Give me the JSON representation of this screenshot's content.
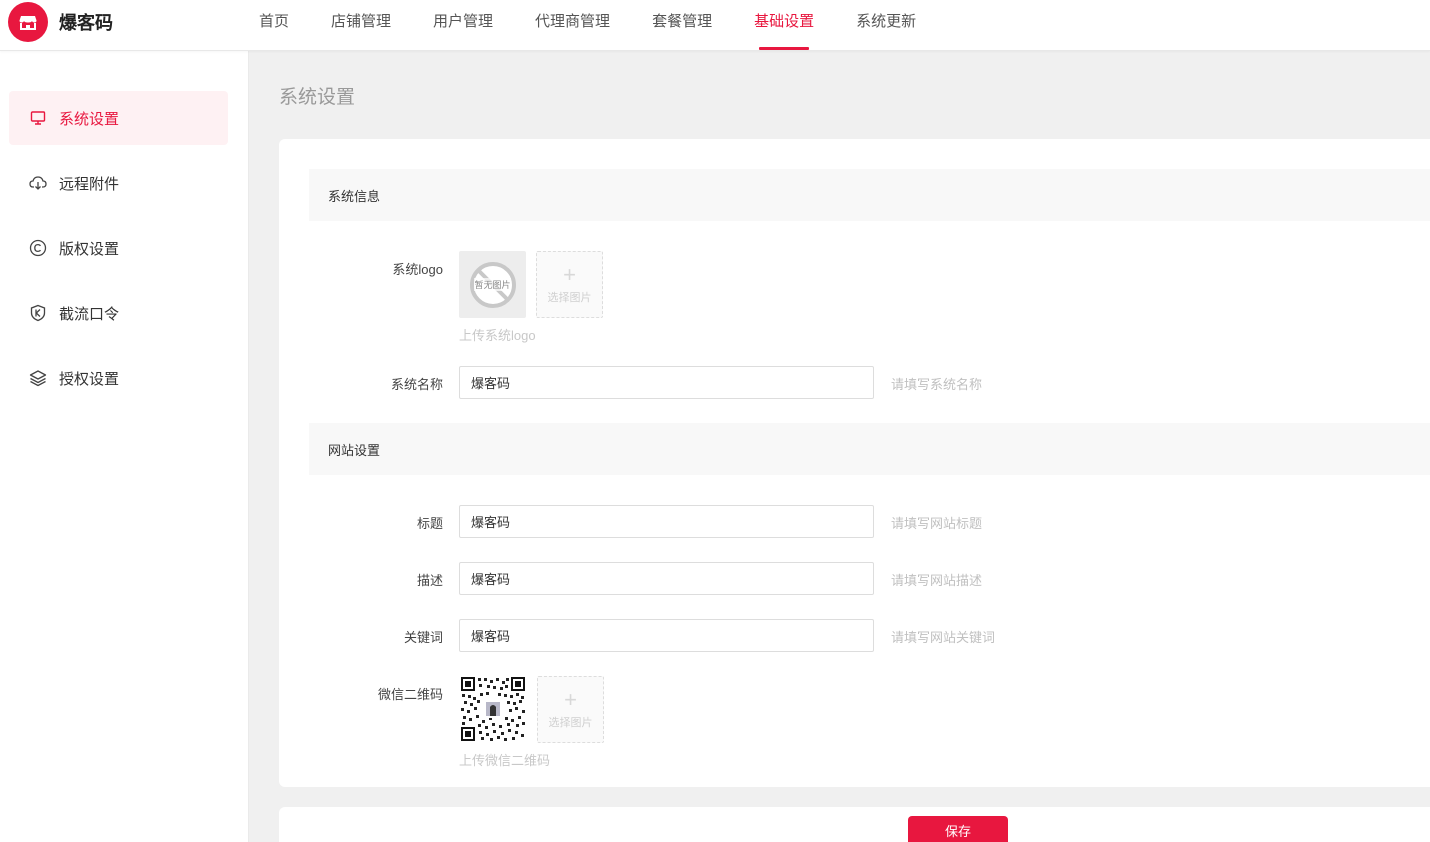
{
  "app": {
    "name": "爆客码",
    "logo_icon": "store-icon",
    "brand_color": "#e8173f"
  },
  "nav": {
    "items": [
      {
        "label": "首页"
      },
      {
        "label": "店铺管理"
      },
      {
        "label": "用户管理"
      },
      {
        "label": "代理商管理"
      },
      {
        "label": "套餐管理"
      },
      {
        "label": "基础设置",
        "active": true
      },
      {
        "label": "系统更新"
      }
    ]
  },
  "sidebar": {
    "items": [
      {
        "label": "系统设置",
        "icon": "monitor-icon",
        "active": true
      },
      {
        "label": "远程附件",
        "icon": "cloud-download-icon"
      },
      {
        "label": "版权设置",
        "icon": "copyright-icon"
      },
      {
        "label": "截流口令",
        "icon": "shield-k-icon"
      },
      {
        "label": "授权设置",
        "icon": "layers-icon"
      }
    ]
  },
  "page": {
    "title": "系统设置"
  },
  "sections": {
    "system_info": {
      "title": "系统信息",
      "logo": {
        "label": "系统logo",
        "placeholder_image_text": "暂无图片",
        "pick_label": "选择图片",
        "hint": "上传系统logo"
      },
      "name": {
        "label": "系统名称",
        "value": "爆客码",
        "hint": "请填写系统名称"
      }
    },
    "site_settings": {
      "title": "网站设置",
      "title_field": {
        "label": "标题",
        "value": "爆客码",
        "hint": "请填写网站标题"
      },
      "description": {
        "label": "描述",
        "value": "爆客码",
        "hint": "请填写网站描述"
      },
      "keywords": {
        "label": "关键词",
        "value": "爆客码",
        "hint": "请填写网站关键词"
      },
      "wechat_qr": {
        "label": "微信二维码",
        "pick_label": "选择图片",
        "hint": "上传微信二维码"
      }
    }
  },
  "actions": {
    "save_label": "保存"
  }
}
